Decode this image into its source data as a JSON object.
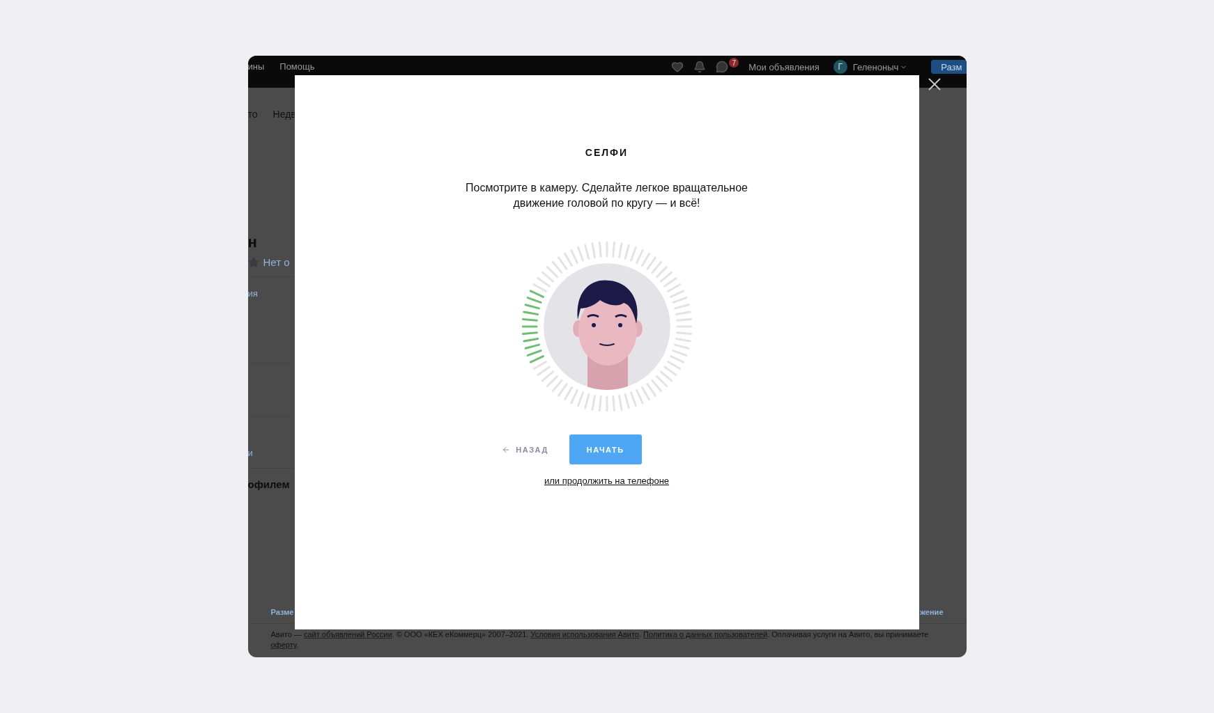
{
  "background_page": {
    "nav": {
      "links": [
        "ины",
        "Помощь"
      ],
      "notification_count": "7",
      "my_ads": "Мои объявления",
      "avatar_letter": "Г",
      "user_name": "Геленоныч",
      "post_button": "Разм"
    },
    "categories": [
      "то",
      "Недв"
    ],
    "profile": {
      "name": "н",
      "rating_text": "Нет о",
      "link_1": "ия",
      "link_2": "и",
      "section_title": "офилем"
    },
    "footer": {
      "link_left": "Разме",
      "link_right": "жение",
      "legal": [
        {
          "kind": "text",
          "text": "Авито — "
        },
        {
          "kind": "link",
          "text": "сайт объявлений России"
        },
        {
          "kind": "text",
          "text": ". © ООО «КЕХ еКоммерц» 2007–2021. "
        },
        {
          "kind": "link",
          "text": "Условия использования Авито"
        },
        {
          "kind": "text",
          "text": ". "
        },
        {
          "kind": "link",
          "text": "Политика о данных пользователей"
        },
        {
          "kind": "text",
          "text": ". Оплачивая услуги на Авито, вы принимаете "
        },
        {
          "kind": "link",
          "text": "оферту"
        },
        {
          "kind": "text",
          "text": "."
        }
      ]
    }
  },
  "modal": {
    "title": "СЕЛФИ",
    "instruction": "Посмотрите в камеру. Сделайте легкое вращательное движение головой по кругу — и всё!",
    "back_button": "НАЗАД",
    "start_button": "НАЧАТЬ",
    "phone_link": "или продолжить на телефоне"
  }
}
